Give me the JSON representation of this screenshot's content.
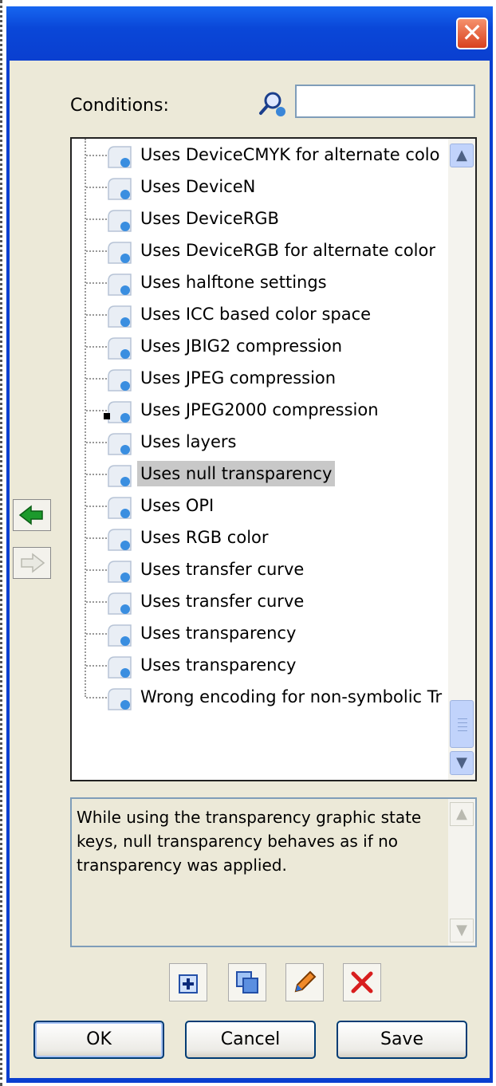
{
  "window": {
    "title": "",
    "close_label": "✕"
  },
  "conditions": {
    "label": "Conditions:",
    "search_value": "",
    "search_placeholder": ""
  },
  "tree": {
    "items": [
      {
        "label": "Uses DeviceCMYK for alternate colo",
        "selected": false,
        "locked": false
      },
      {
        "label": "Uses DeviceN",
        "selected": false,
        "locked": false
      },
      {
        "label": "Uses DeviceRGB",
        "selected": false,
        "locked": false
      },
      {
        "label": "Uses DeviceRGB for alternate color",
        "selected": false,
        "locked": false
      },
      {
        "label": "Uses halftone settings",
        "selected": false,
        "locked": false
      },
      {
        "label": "Uses ICC based color space",
        "selected": false,
        "locked": false
      },
      {
        "label": "Uses JBIG2 compression",
        "selected": false,
        "locked": false
      },
      {
        "label": "Uses JPEG compression",
        "selected": false,
        "locked": false
      },
      {
        "label": "Uses JPEG2000 compression",
        "selected": false,
        "locked": true
      },
      {
        "label": "Uses layers",
        "selected": false,
        "locked": false
      },
      {
        "label": "Uses null transparency",
        "selected": true,
        "locked": false
      },
      {
        "label": "Uses OPI",
        "selected": false,
        "locked": false
      },
      {
        "label": "Uses RGB color",
        "selected": false,
        "locked": false
      },
      {
        "label": "Uses transfer curve",
        "selected": false,
        "locked": false
      },
      {
        "label": "Uses transfer curve",
        "selected": false,
        "locked": false
      },
      {
        "label": "Uses transparency",
        "selected": false,
        "locked": false
      },
      {
        "label": "Uses transparency",
        "selected": false,
        "locked": false
      },
      {
        "label": "Wrong encoding for non-symbolic Tr",
        "selected": false,
        "locked": false
      }
    ]
  },
  "description": {
    "text": "While using the transparency graphic state keys, null transparency behaves as if no transparency was applied."
  },
  "buttons": {
    "ok": "OK",
    "cancel": "Cancel",
    "save": "Save"
  },
  "colors": {
    "titlebar": "#0a3fd0",
    "face": "#ece9d8",
    "selection": "#c8c8c8",
    "close": "#d8411f"
  }
}
